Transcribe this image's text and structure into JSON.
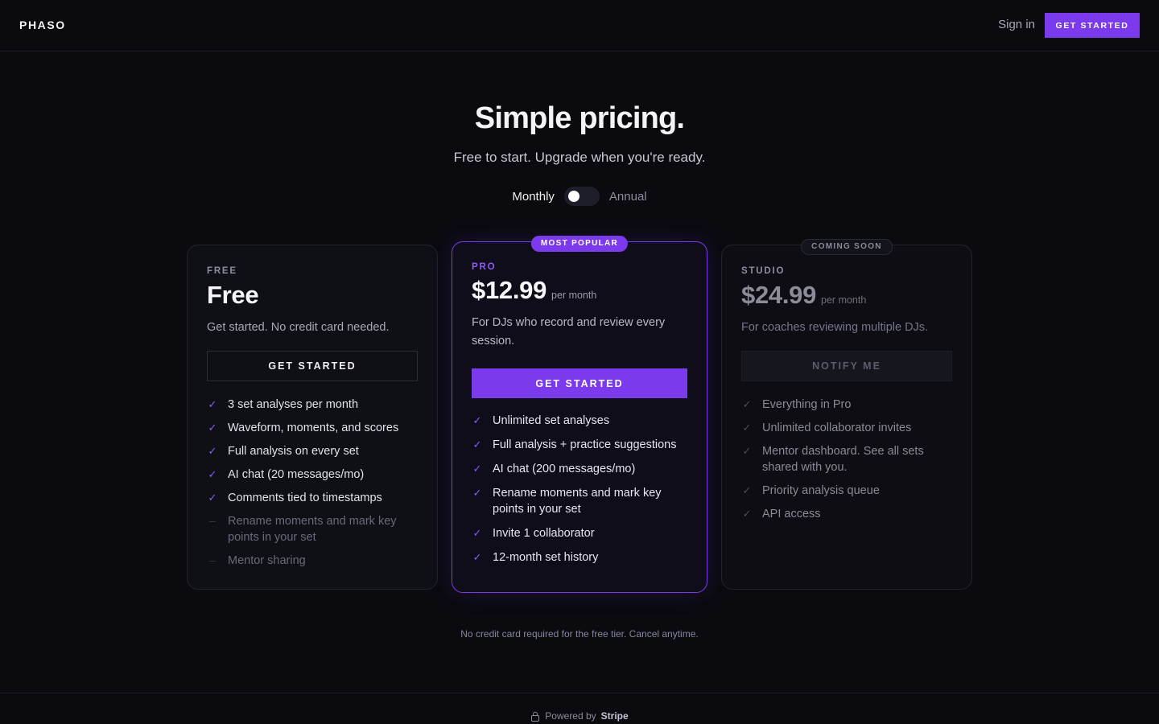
{
  "nav": {
    "logo": "PHASO",
    "signin": "Sign in",
    "cta": "GET STARTED"
  },
  "hero": {
    "title": "Simple pricing.",
    "subtitle": "Free to start. Upgrade when you're ready."
  },
  "billing": {
    "monthly": "Monthly",
    "annual": "Annual",
    "annual_enabled": false
  },
  "plans": {
    "free": {
      "tier": "FREE",
      "price": "Free",
      "description": "Get started. No credit card needed.",
      "cta": "GET STARTED",
      "features": [
        {
          "text": "3 set analyses per month",
          "included": true,
          "mark": "check-icon"
        },
        {
          "text": "Waveform, moments, and scores",
          "included": true,
          "mark": "check-icon"
        },
        {
          "text": "Full analysis on every set",
          "included": true,
          "mark": "check-icon"
        },
        {
          "text": "AI chat (20 messages/mo)",
          "included": true,
          "mark": "check-icon"
        },
        {
          "text": "Comments tied to timestamps",
          "included": true,
          "mark": "check-icon"
        },
        {
          "text": "Rename moments and mark key points in your set",
          "included": false,
          "mark": "dash-icon"
        },
        {
          "text": "Mentor sharing",
          "included": false,
          "mark": "dash-icon"
        }
      ]
    },
    "pro": {
      "badge": "MOST POPULAR",
      "tier": "PRO",
      "price": "$12.99",
      "period": "per month",
      "description": "For DJs who record and review every session.",
      "cta": "GET STARTED",
      "features": [
        {
          "text": "Unlimited set analyses",
          "included": true,
          "mark": "check-icon"
        },
        {
          "text": "Full analysis + practice suggestions",
          "included": true,
          "mark": "check-icon"
        },
        {
          "text": "AI chat (200 messages/mo)",
          "included": true,
          "mark": "check-icon"
        },
        {
          "text": "Rename moments and mark key points in your set",
          "included": true,
          "mark": "check-icon"
        },
        {
          "text": "Invite 1 collaborator",
          "included": true,
          "mark": "check-icon"
        },
        {
          "text": "12-month set history",
          "included": true,
          "mark": "check-icon"
        }
      ]
    },
    "studio": {
      "badge": "COMING SOON",
      "tier": "STUDIO",
      "price": "$24.99",
      "period": "per month",
      "description": "For coaches reviewing multiple DJs.",
      "cta": "NOTIFY ME",
      "features": [
        {
          "text": "Everything in Pro",
          "included": true,
          "mark": "check-icon"
        },
        {
          "text": "Unlimited collaborator invites",
          "included": true,
          "mark": "check-icon"
        },
        {
          "text": "Mentor dashboard. See all sets shared with you.",
          "included": true,
          "mark": "check-icon"
        },
        {
          "text": "Priority analysis queue",
          "included": true,
          "mark": "check-icon"
        },
        {
          "text": "API access",
          "included": true,
          "mark": "check-icon"
        }
      ]
    }
  },
  "footnote": "No credit card required for the free tier. Cancel anytime.",
  "footer": {
    "powered_by": "Powered by",
    "provider": "Stripe",
    "icon": "lock-icon"
  },
  "colors": {
    "background": "#0a0a0f",
    "accent": "#7c3aed",
    "accent_text": "#8b5cf6",
    "card_border": "#23232e"
  }
}
